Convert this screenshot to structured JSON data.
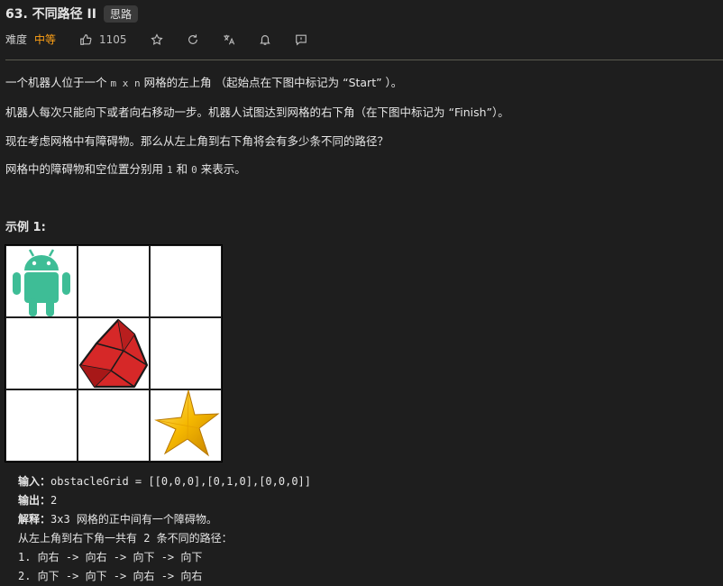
{
  "header": {
    "title": "63. 不同路径 II",
    "hint_button": "思路"
  },
  "meta": {
    "difficulty_label": "难度",
    "difficulty": "中等",
    "like_count": "1105",
    "icons": [
      "thumbs-up-icon",
      "star-icon",
      "refresh-icon",
      "translate-icon",
      "bell-icon",
      "comment-icon"
    ]
  },
  "description": {
    "p1_a": "一个机器人位于一个",
    "p1_code": "m x n",
    "p1_b": "网格的左上角 （起始点在下图中标记为 “Start” ）。",
    "p2": "机器人每次只能向下或者向右移动一步。机器人试图达到网格的右下角（在下图中标记为 “Finish”）。",
    "p3": "现在考虑网格中有障碍物。那么从左上角到右下角将会有多少条不同的路径？",
    "p4_a": "网格中的障碍物和空位置分别用",
    "p4_code1": "1",
    "p4_mid": "和",
    "p4_code2": "0",
    "p4_b": "来表示。"
  },
  "example": {
    "title": "示例 1:",
    "grid_icons": [
      "android-robot-icon",
      "ruby-gem-icon",
      "gold-star-icon"
    ],
    "input_label": "输入：",
    "input_value": "obstacleGrid = [[0,0,0],[0,1,0],[0,0,0]]",
    "output_label": "输出：",
    "output_value": "2",
    "explain_label": "解释：",
    "explain_value": "3x3 网格的正中间有一个障碍物。",
    "line4": "从左上角到右下角一共有 2 条不同的路径：",
    "line5": "1. 向右 -> 向右 -> 向下 -> 向下",
    "line6": "2. 向下 -> 向下 -> 向右 -> 向右"
  },
  "colors": {
    "background": "#1e1e1e",
    "difficulty_medium": "#ffa116",
    "android_green": "#3ddc84",
    "ruby_red": "#d62828",
    "star_gold": "#f5b800"
  }
}
